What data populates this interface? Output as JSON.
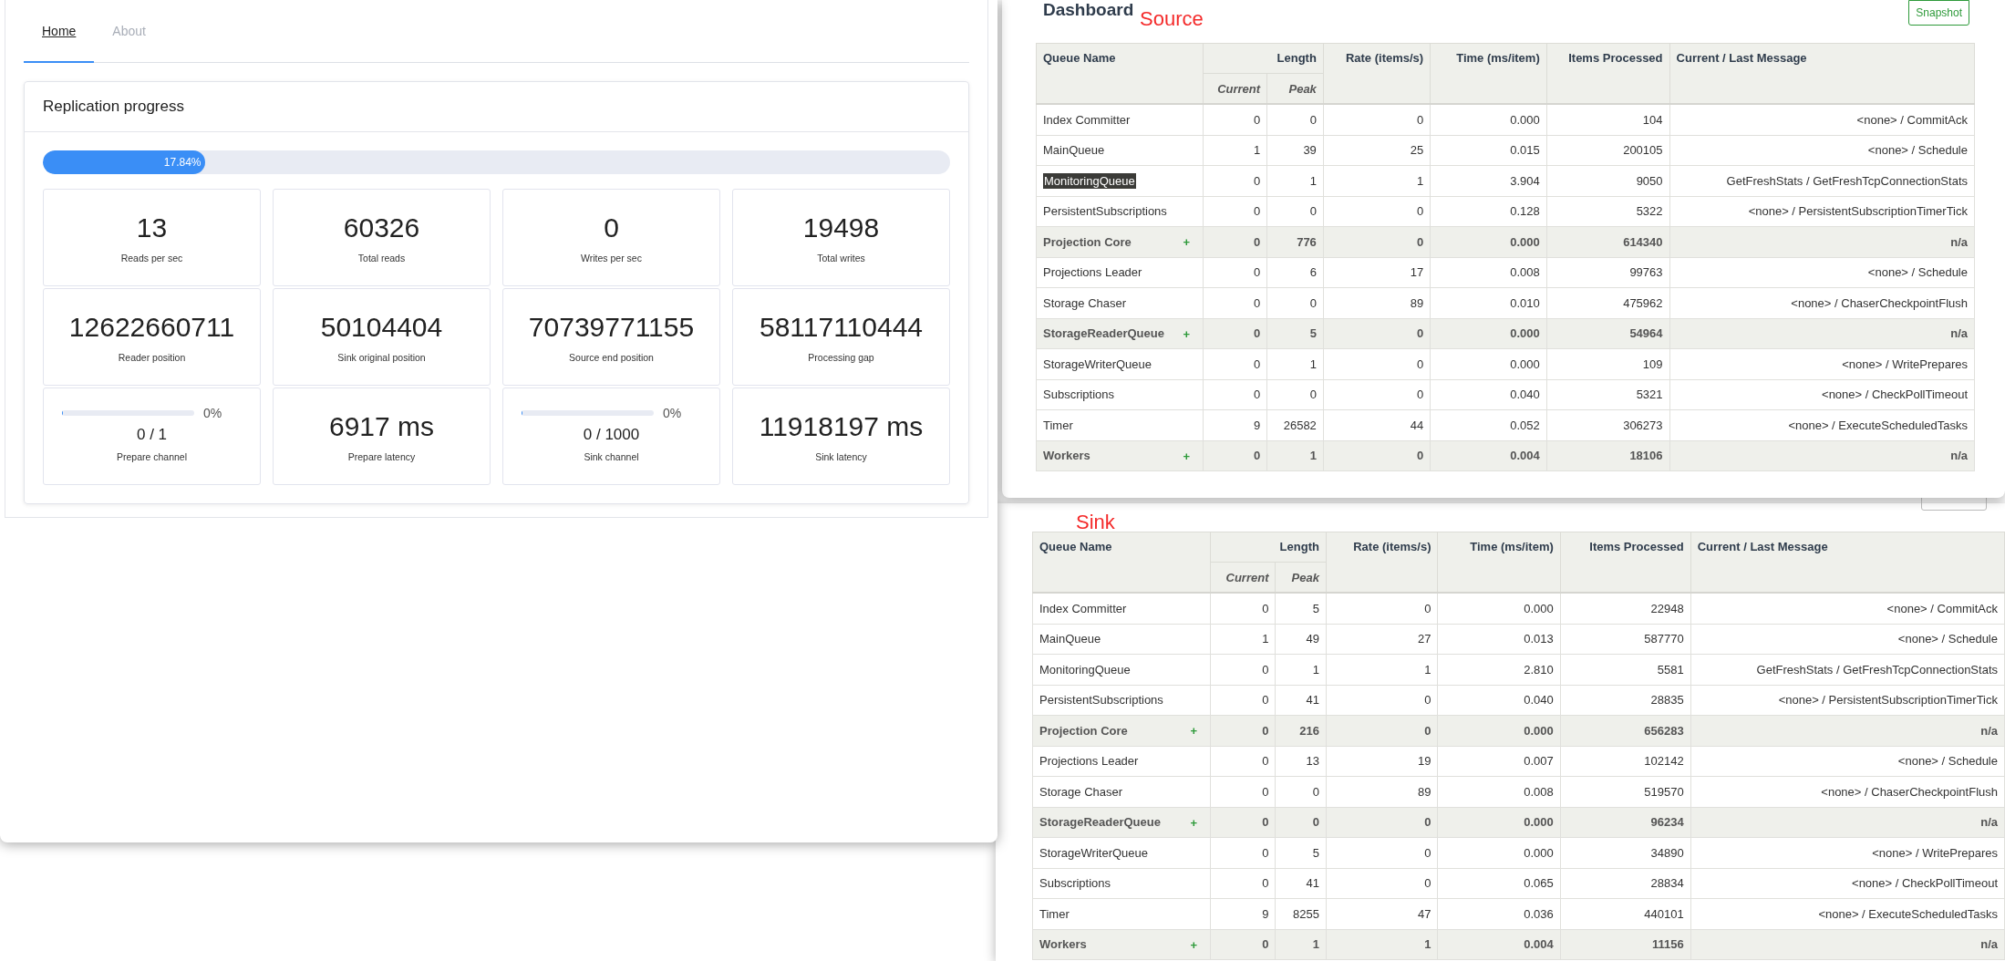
{
  "left_window": {
    "tabs": [
      {
        "label": "Home",
        "selected": true
      },
      {
        "label": "About",
        "selected": false
      }
    ],
    "card": {
      "title": "Replication progress",
      "progress": {
        "level": 0.1784,
        "label": "17.84%"
      },
      "stats": [
        {
          "kind": "stat",
          "value": "13",
          "label": "Reads per sec"
        },
        {
          "kind": "stat",
          "value": "60326",
          "label": "Total reads"
        },
        {
          "kind": "stat",
          "value": "0",
          "label": "Writes per sec"
        },
        {
          "kind": "stat",
          "value": "19498",
          "label": "Total writes"
        },
        {
          "kind": "stat",
          "value": "12622660711",
          "label": "Reader position"
        },
        {
          "kind": "stat",
          "value": "50104404",
          "label": "Sink original position"
        },
        {
          "kind": "stat",
          "value": "70739771155",
          "label": "Source end position"
        },
        {
          "kind": "stat",
          "value": "58117110444",
          "label": "Processing gap"
        },
        {
          "kind": "channel",
          "level": 0,
          "percent": "0%",
          "value": "0 / 1",
          "label": "Prepare channel"
        },
        {
          "kind": "stat",
          "value": "6917 ms",
          "label": "Prepare latency"
        },
        {
          "kind": "channel",
          "level": 0,
          "percent": "0%",
          "value": "0 / 1000",
          "label": "Sink channel"
        },
        {
          "kind": "stat",
          "value": "11918197 ms",
          "label": "Sink latency"
        }
      ]
    }
  },
  "source": {
    "title": "Dashboard",
    "caption": "Source",
    "snapshot_button": "Snapshot",
    "columns": {
      "name": "Queue Name",
      "length": "Length",
      "current": "Current",
      "peak": "Peak",
      "rate": "Rate (items/s)",
      "time": "Time (ms/item)",
      "items": "Items Processed",
      "message": "Current / Last Message"
    },
    "rows": [
      {
        "kind": "queue",
        "selected": false,
        "name": "Index Committer",
        "current": "0",
        "peak": "0",
        "rate": "0",
        "time": "0.000",
        "items": "104",
        "message": "<none> / CommitAck"
      },
      {
        "kind": "queue",
        "selected": false,
        "name": "MainQueue",
        "current": "1",
        "peak": "39",
        "rate": "25",
        "time": "0.015",
        "items": "200105",
        "message": "<none> / Schedule"
      },
      {
        "kind": "queue",
        "selected": true,
        "name": "MonitoringQueue",
        "current": "0",
        "peak": "1",
        "rate": "1",
        "time": "3.904",
        "items": "9050",
        "message": "GetFreshStats / GetFreshTcpConnectionStats"
      },
      {
        "kind": "queue",
        "selected": false,
        "name": "PersistentSubscriptions",
        "current": "0",
        "peak": "0",
        "rate": "0",
        "time": "0.128",
        "items": "5322",
        "message": "<none> / PersistentSubscriptionTimerTick"
      },
      {
        "kind": "group",
        "selected": false,
        "name": "Projection Core",
        "expand": "+",
        "current": "0",
        "peak": "776",
        "rate": "0",
        "time": "0.000",
        "items": "614340",
        "message": "n/a"
      },
      {
        "kind": "queue",
        "selected": false,
        "name": "Projections Leader",
        "current": "0",
        "peak": "6",
        "rate": "17",
        "time": "0.008",
        "items": "99763",
        "message": "<none> / Schedule"
      },
      {
        "kind": "queue",
        "selected": false,
        "name": "Storage Chaser",
        "current": "0",
        "peak": "0",
        "rate": "89",
        "time": "0.010",
        "items": "475962",
        "message": "<none> / ChaserCheckpointFlush"
      },
      {
        "kind": "group",
        "selected": false,
        "name": "StorageReaderQueue",
        "expand": "+",
        "current": "0",
        "peak": "5",
        "rate": "0",
        "time": "0.000",
        "items": "54964",
        "message": "n/a"
      },
      {
        "kind": "queue",
        "selected": false,
        "name": "StorageWriterQueue",
        "current": "0",
        "peak": "1",
        "rate": "0",
        "time": "0.000",
        "items": "109",
        "message": "<none> / WritePrepares"
      },
      {
        "kind": "queue",
        "selected": false,
        "name": "Subscriptions",
        "current": "0",
        "peak": "0",
        "rate": "0",
        "time": "0.040",
        "items": "5321",
        "message": "<none> / CheckPollTimeout"
      },
      {
        "kind": "queue",
        "selected": false,
        "name": "Timer",
        "current": "9",
        "peak": "26582",
        "rate": "44",
        "time": "0.052",
        "items": "306273",
        "message": "<none> / ExecuteScheduledTasks"
      },
      {
        "kind": "group",
        "selected": false,
        "name": "Workers",
        "expand": "+",
        "current": "0",
        "peak": "1",
        "rate": "0",
        "time": "0.004",
        "items": "18106",
        "message": "n/a"
      }
    ]
  },
  "sink": {
    "caption": "Sink",
    "columns": {
      "name": "Queue Name",
      "length": "Length",
      "current": "Current",
      "peak": "Peak",
      "rate": "Rate (items/s)",
      "time": "Time (ms/item)",
      "items": "Items Processed",
      "message": "Current / Last Message"
    },
    "rows": [
      {
        "kind": "queue",
        "selected": false,
        "name": "Index Committer",
        "current": "0",
        "peak": "5",
        "rate": "0",
        "time": "0.000",
        "items": "22948",
        "message": "<none> / CommitAck"
      },
      {
        "kind": "queue",
        "selected": false,
        "name": "MainQueue",
        "current": "1",
        "peak": "49",
        "rate": "27",
        "time": "0.013",
        "items": "587770",
        "message": "<none> / Schedule"
      },
      {
        "kind": "queue",
        "selected": false,
        "name": "MonitoringQueue",
        "current": "0",
        "peak": "1",
        "rate": "1",
        "time": "2.810",
        "items": "5581",
        "message": "GetFreshStats / GetFreshTcpConnectionStats"
      },
      {
        "kind": "queue",
        "selected": false,
        "name": "PersistentSubscriptions",
        "current": "0",
        "peak": "41",
        "rate": "0",
        "time": "0.040",
        "items": "28835",
        "message": "<none> / PersistentSubscriptionTimerTick"
      },
      {
        "kind": "group",
        "selected": false,
        "name": "Projection Core",
        "expand": "+",
        "current": "0",
        "peak": "216",
        "rate": "0",
        "time": "0.000",
        "items": "656283",
        "message": "n/a"
      },
      {
        "kind": "queue",
        "selected": false,
        "name": "Projections Leader",
        "current": "0",
        "peak": "13",
        "rate": "19",
        "time": "0.007",
        "items": "102142",
        "message": "<none> / Schedule"
      },
      {
        "kind": "queue",
        "selected": false,
        "name": "Storage Chaser",
        "current": "0",
        "peak": "0",
        "rate": "89",
        "time": "0.008",
        "items": "519570",
        "message": "<none> / ChaserCheckpointFlush"
      },
      {
        "kind": "group",
        "selected": false,
        "name": "StorageReaderQueue",
        "expand": "+",
        "current": "0",
        "peak": "0",
        "rate": "0",
        "time": "0.000",
        "items": "96234",
        "message": "n/a"
      },
      {
        "kind": "queue",
        "selected": false,
        "name": "StorageWriterQueue",
        "current": "0",
        "peak": "5",
        "rate": "0",
        "time": "0.000",
        "items": "34890",
        "message": "<none> / WritePrepares"
      },
      {
        "kind": "queue",
        "selected": false,
        "name": "Subscriptions",
        "current": "0",
        "peak": "41",
        "rate": "0",
        "time": "0.065",
        "items": "28834",
        "message": "<none> / CheckPollTimeout"
      },
      {
        "kind": "queue",
        "selected": false,
        "name": "Timer",
        "current": "9",
        "peak": "8255",
        "rate": "47",
        "time": "0.036",
        "items": "440101",
        "message": "<none> / ExecuteScheduledTasks"
      },
      {
        "kind": "group",
        "selected": false,
        "name": "Workers",
        "expand": "+",
        "current": "0",
        "peak": "1",
        "rate": "1",
        "time": "0.004",
        "items": "11156",
        "message": "n/a"
      }
    ]
  }
}
